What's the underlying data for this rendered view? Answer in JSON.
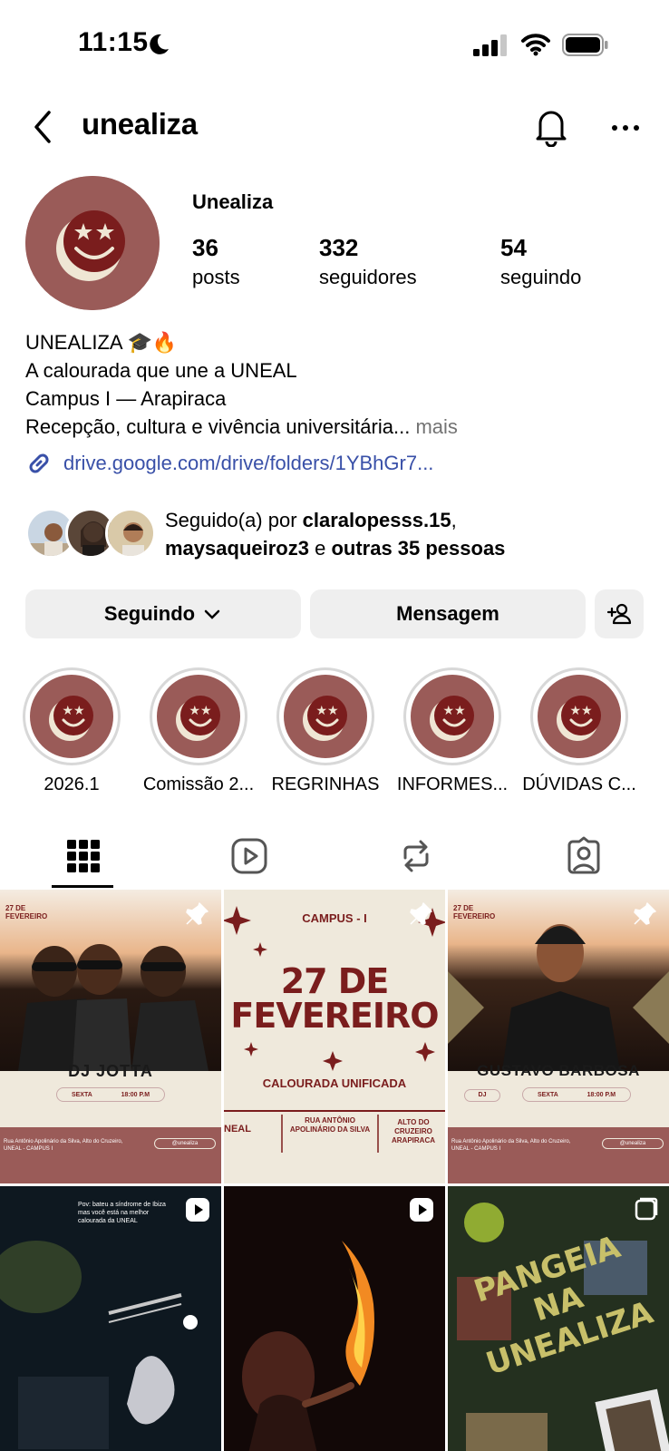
{
  "status": {
    "time": "11:15"
  },
  "nav": {
    "username": "unealiza"
  },
  "profile": {
    "display_name": "Unealiza",
    "stats": [
      {
        "value": "36",
        "label": "posts"
      },
      {
        "value": "332",
        "label": "seguidores"
      },
      {
        "value": "54",
        "label": "seguindo"
      }
    ],
    "bio": [
      "UNEALIZA 🎓🔥",
      "A calourada que une a UNEAL",
      "Campus I — Arapiraca",
      "Recepção, cultura e vivência universitária..."
    ],
    "bio_more": "mais",
    "link": "drive.google.com/drive/folders/1YBhGr7..."
  },
  "followed_by": {
    "prefix": "Seguido(a) por ",
    "user1": "claralopesss.15",
    "sep": ",",
    "user2": "maysaqueiroz3",
    "conj": " e ",
    "others": "outras 35 pessoas"
  },
  "buttons": {
    "following": "Seguindo",
    "message": "Mensagem"
  },
  "highlights": [
    "2026.1",
    "Comissão 2...",
    "REGRINHAS",
    "INFORMES...",
    "DÚVIDAS C..."
  ],
  "posts": [
    {
      "date_label": "27 DE FEVEREIRO",
      "artist": "DJ JOTTA",
      "day": "SEXTA",
      "time": "18:00 P.M",
      "address": "Rua Antônio Apolinário da Silva, Alto do Cruzeiro, UNEAL - CAMPUS I",
      "handle": "@unealiza"
    },
    {
      "campus": "CAMPUS - I",
      "big_line1": "27 DE",
      "big_line2": "FEVEREIRO",
      "subtitle": "CALOURADA UNIFICADA",
      "col1": "NEAL",
      "col2": "RUA ANTÔNIO APOLINÁRIO DA SILVA",
      "col3": "ALTO DO CRUZEIRO ARAPIRACA"
    },
    {
      "date_label": "27 DE FEVEREIRO",
      "artist": "GUSTAVO BARBOSA",
      "role": "DJ",
      "day": "SEXTA",
      "time": "18:00 P.M",
      "address": "Rua Antônio Apolinário da Silva, Alto do Cruzeiro, UNEAL - CAMPUS I",
      "handle": "@unealiza"
    },
    {
      "caption": "Pov: bateu a síndrome de Ibiza mas você está na melhor calourada da UNEAL"
    },
    {},
    {
      "line1": "PANGEIA",
      "line2": "NA",
      "line3": "UNEALIZA"
    }
  ],
  "colors": {
    "brand": "#9a5b58",
    "dark_red": "#7a1d1d",
    "cream": "#efe9dc",
    "link": "#3950a8"
  },
  "icons": [
    "moon-icon",
    "signal-icon",
    "wifi-icon",
    "battery-icon",
    "back-icon",
    "bell-icon",
    "more-icon",
    "link-icon",
    "chevron-down-icon",
    "add-person-icon",
    "grid-icon",
    "reels-icon",
    "repost-icon",
    "tagged-icon",
    "pin-icon"
  ]
}
